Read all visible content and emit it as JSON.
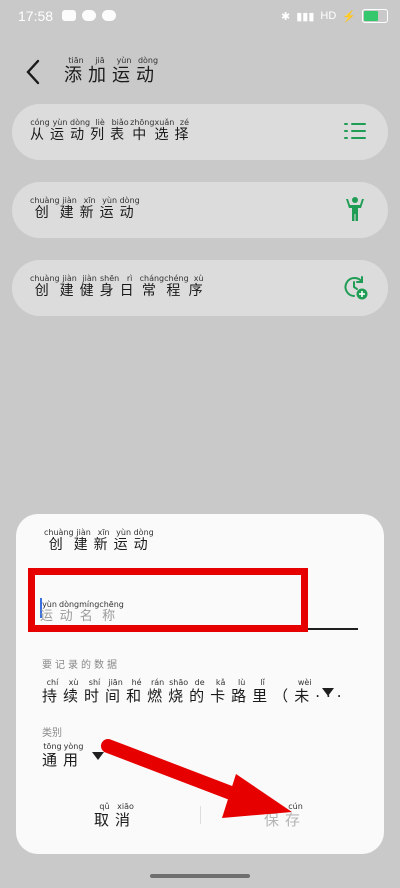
{
  "status": {
    "time": "17:58",
    "network": "HD",
    "battery_icon": "battery-icon"
  },
  "header": {
    "title_chars": [
      {
        "c": "添",
        "p": "tiān"
      },
      {
        "c": "加",
        "p": "jiā"
      },
      {
        "c": "运",
        "p": "yùn"
      },
      {
        "c": "动",
        "p": "dòng"
      }
    ]
  },
  "cards": [
    {
      "chars": [
        {
          "c": "从",
          "p": "cóng"
        },
        {
          "c": "运",
          "p": "yùn"
        },
        {
          "c": "动",
          "p": "dòng"
        },
        {
          "c": "列",
          "p": "liè"
        },
        {
          "c": "表",
          "p": "biǎo"
        },
        {
          "c": "中",
          "p": "zhōng"
        },
        {
          "c": "选",
          "p": "xuǎn"
        },
        {
          "c": "择",
          "p": "zé"
        }
      ],
      "icon": "list-icon"
    },
    {
      "chars": [
        {
          "c": "创",
          "p": "chuàng"
        },
        {
          "c": "建",
          "p": "jiàn"
        },
        {
          "c": "新",
          "p": "xīn"
        },
        {
          "c": "运",
          "p": "yùn"
        },
        {
          "c": "动",
          "p": "dòng"
        }
      ],
      "icon": "person-icon"
    },
    {
      "chars": [
        {
          "c": "创",
          "p": "chuàng"
        },
        {
          "c": "建",
          "p": "jiàn"
        },
        {
          "c": "健",
          "p": "jiàn"
        },
        {
          "c": "身",
          "p": "shēn"
        },
        {
          "c": "日",
          "p": "rì"
        },
        {
          "c": "常",
          "p": "cháng"
        },
        {
          "c": "程",
          "p": "chéng"
        },
        {
          "c": "序",
          "p": "xù"
        }
      ],
      "icon": "schedule-add-icon"
    }
  ],
  "sheet": {
    "title_chars": [
      {
        "c": "创",
        "p": "chuàng"
      },
      {
        "c": "建",
        "p": "jiàn"
      },
      {
        "c": "新",
        "p": "xīn"
      },
      {
        "c": "运",
        "p": "yùn"
      },
      {
        "c": "动",
        "p": "dòng"
      }
    ],
    "name_placeholder_chars": [
      {
        "c": "运",
        "p": "yùn"
      },
      {
        "c": "动",
        "p": "dòng"
      },
      {
        "c": "名",
        "p": "míng"
      },
      {
        "c": "称",
        "p": "chēng"
      }
    ],
    "record_label": "要记录的数据",
    "record_value_chars": [
      {
        "c": "持",
        "p": "chí"
      },
      {
        "c": "续",
        "p": "xù"
      },
      {
        "c": "时",
        "p": "shí"
      },
      {
        "c": "间",
        "p": "jiān"
      },
      {
        "c": "和",
        "p": "hé"
      },
      {
        "c": "燃",
        "p": "rán"
      },
      {
        "c": "烧",
        "p": "shāo"
      },
      {
        "c": "的",
        "p": "de"
      },
      {
        "c": "卡",
        "p": "kǎ"
      },
      {
        "c": "路",
        "p": "lù"
      },
      {
        "c": "里",
        "p": "lǐ"
      },
      {
        "c": "（",
        "p": ""
      },
      {
        "c": "未",
        "p": "wèi"
      },
      {
        "c": "···",
        "p": ""
      }
    ],
    "category_label": "类别",
    "category_value_chars": [
      {
        "c": "通",
        "p": "tōng"
      },
      {
        "c": "用",
        "p": "yòng"
      }
    ],
    "cancel_chars": [
      {
        "c": "取",
        "p": "qǔ"
      },
      {
        "c": "消",
        "p": "xiāo"
      }
    ],
    "save_chars": [
      {
        "c": "保",
        "p": "bǎo"
      },
      {
        "c": "存",
        "p": "cún"
      }
    ]
  },
  "colors": {
    "accent_green": "#1f9d55",
    "annotation_red": "#e70000"
  }
}
